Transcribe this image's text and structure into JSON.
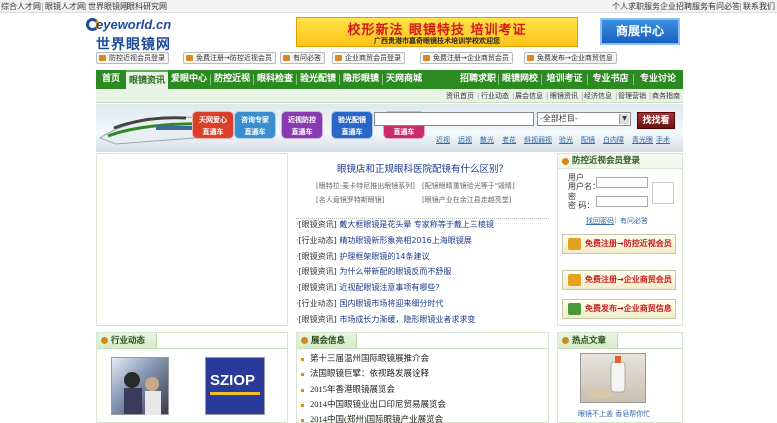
{
  "topbar": {
    "left_links": [
      "综合人才网",
      "眼镜人才网",
      "世界眼镜网",
      "眼科研究网"
    ],
    "right_links": [
      "个人求职服务",
      "企业招聘服务",
      "有问必答",
      "联系我们"
    ]
  },
  "logo": {
    "latin": "eyeworld.cn",
    "chinese": "世界眼镜网"
  },
  "banner": {
    "line1": "校形新法 眼镜特技 培训考证",
    "line2": "广西贵港市嘉奇眼镜技术培训学校欢迎您"
  },
  "biz_button": "商展中心",
  "pills": [
    "防控近视会员登录",
    "免费注册→防控近视会员",
    "有问必答",
    "企业商贸会员登录",
    "免费注册→企业商贸会员",
    "免费发布→企业商贸信息"
  ],
  "nav": {
    "items": [
      "首页",
      "眼镜资讯",
      "爱眼中心",
      "防控近视",
      "眼科检查",
      "验光配镜",
      "隐形眼镜",
      "天网商城",
      "招聘求职",
      "眼镜网校",
      "培训考证",
      "专业书店",
      "专业讨论"
    ],
    "active": "眼镜资讯"
  },
  "subnav": [
    "资讯首页",
    "行业动态",
    "展会信息",
    "眼镜资讯",
    "经济信息",
    "管理营销",
    "商务指南"
  ],
  "hero": {
    "buttons": [
      "天网爱心\n直通车",
      "咨询专家\n直通车",
      "近视防控\n直通车",
      "验光配镜\n直通车",
      "网上购物\n直通车"
    ],
    "select_value": "-全部栏目-",
    "search_button": "找找看",
    "keywords": [
      "近视",
      "远视",
      "散光",
      "老花",
      "斜视弱视",
      "验光",
      "配镜",
      "白内障",
      "青光眼",
      "手术"
    ]
  },
  "center": {
    "headline": "眼镜店和正规眼科医院配镜有什么区别？",
    "sub_links": [
      "[眼特拉-麦卡特尼推出眼镜系列]",
      "[配镜眼睛重镜验光等于\"毁睛]",
      "[名人竟镜罗特斯眼镜]",
      "[眼镜产业在余江县走越亮堂]"
    ],
    "news": [
      {
        "cat": "[眼镜资讯]",
        "title": "戴大框眼镜是花头晕 专家称等于戴上三棱镜"
      },
      {
        "cat": "[行业动态]",
        "title": "精功眼镜新形象亮相2016上海眼镜展"
      },
      {
        "cat": "[眼镜资讯]",
        "title": "护理框架眼镜的14条建议"
      },
      {
        "cat": "[眼镜资讯]",
        "title": "为什么带新配的眼镜反而不舒服"
      },
      {
        "cat": "[眼镜资讯]",
        "title": "近视配眼镜注意事项有哪些？"
      },
      {
        "cat": "[行业动态]",
        "title": "国内眼镜市场将迎来细分时代"
      },
      {
        "cat": "[眼镜资讯]",
        "title": "市场成长力渐缓，隐形眼镜业者求求变"
      }
    ]
  },
  "login": {
    "title": "防控近视会员登录",
    "user_label": "用户名：",
    "pass_label": "密 码：",
    "forgot": "找回密码",
    "ask": "有问必答",
    "btn1": "免费注册→防控近视会员",
    "btn2": "免费注册→企业商贸会员",
    "btn3": "免费发布→企业商贸信息"
  },
  "industry": {
    "title": "行业动态",
    "thumb_text": "SZIOP"
  },
  "expo": {
    "title": "展会信息",
    "items": [
      "第十三届温州国际眼镜展推介会",
      "法国眼镜巨擘：依视路发展诠释",
      "2015年香港眼镜展览会",
      "2014中国眼镜业出口印尼贸易展览会",
      "2014中国(郑州)国际眼镜产业展览会"
    ]
  },
  "hot": {
    "title": "热点文章",
    "caption": "眼镜不上盖 香皂帮你忙"
  },
  "colors": {
    "nav_green": "#2d8a22",
    "link_blue": "#1a3a8a",
    "accent_red": "#c81e1e",
    "accent_orange": "#d08820"
  }
}
